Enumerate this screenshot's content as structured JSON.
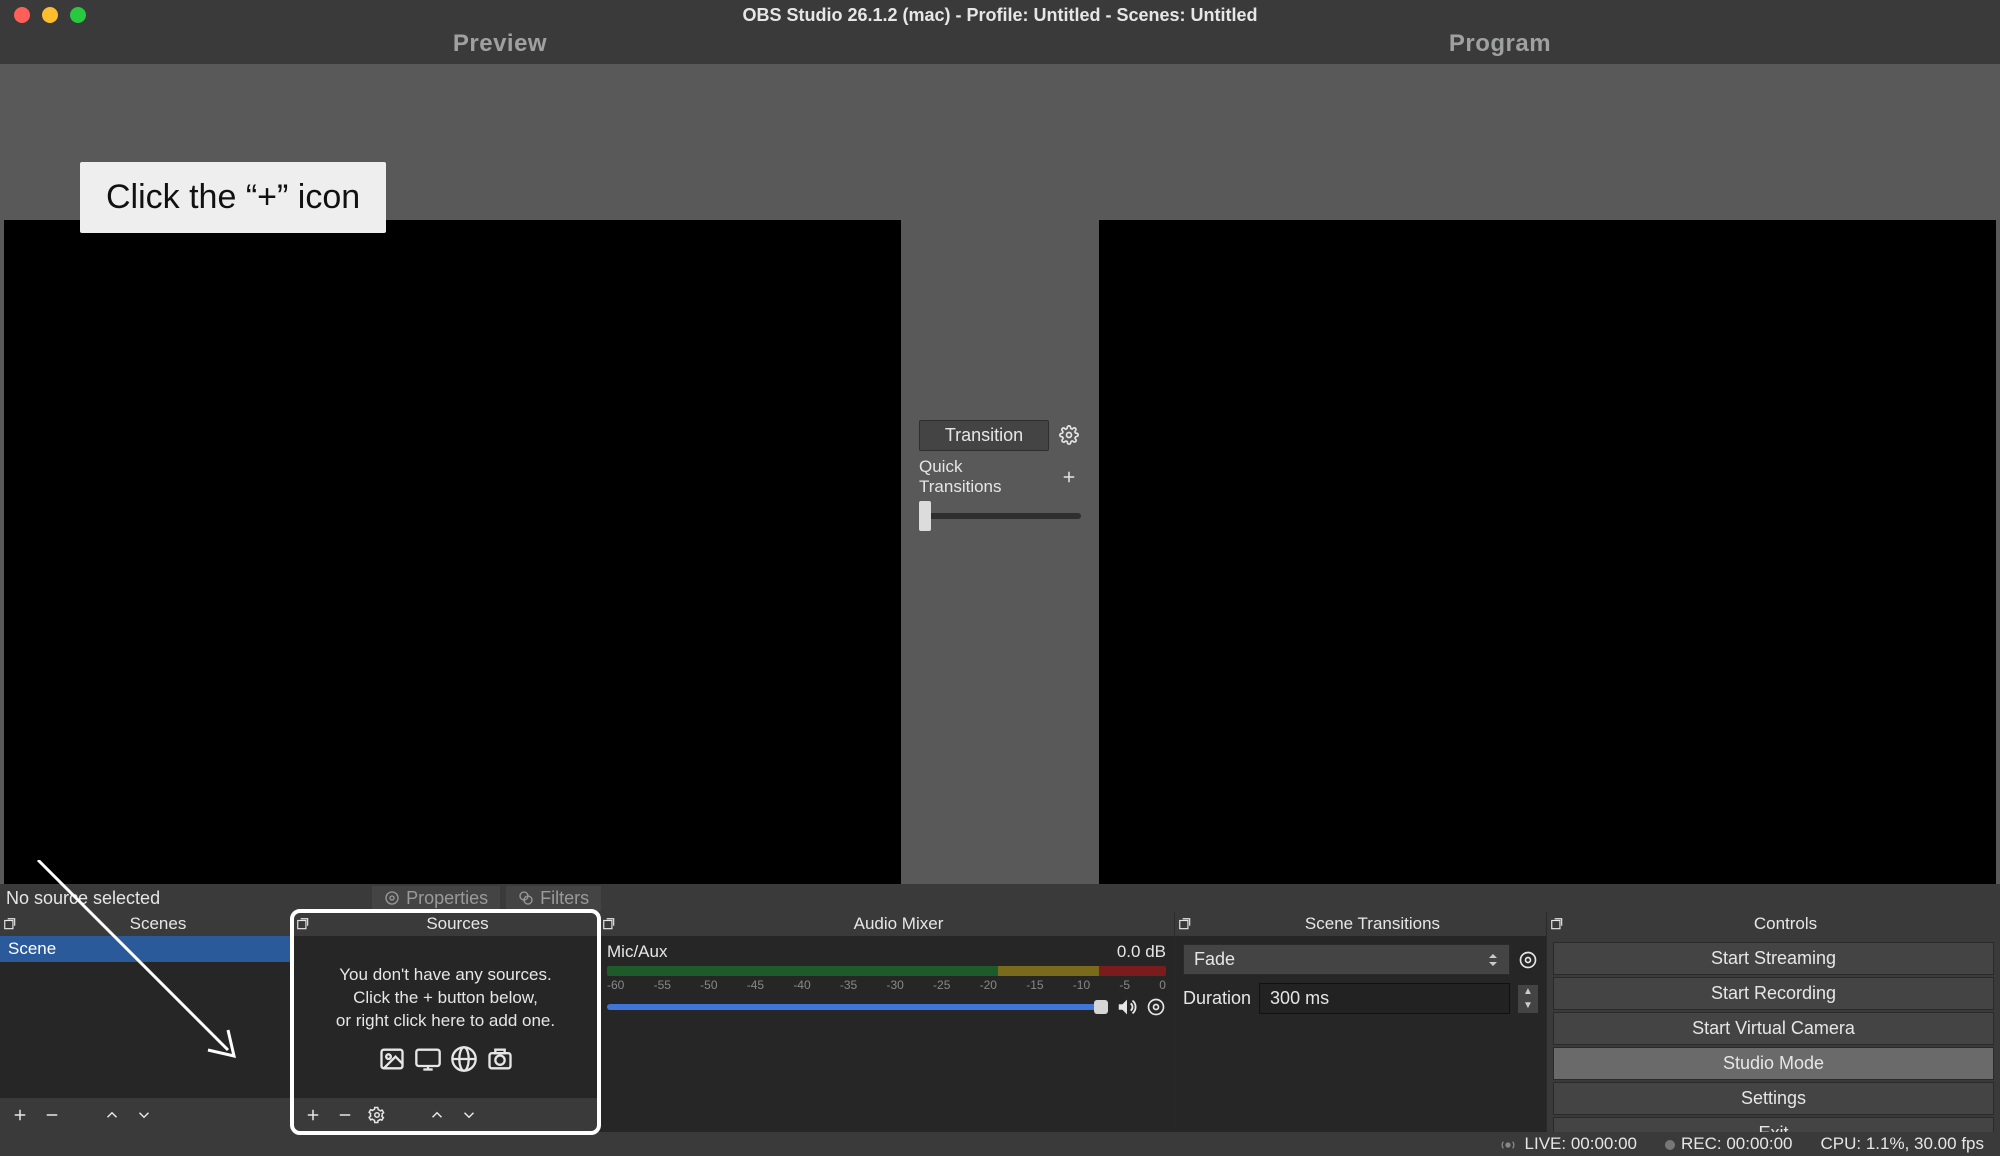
{
  "window": {
    "title": "OBS Studio 26.1.2 (mac) - Profile: Untitled - Scenes: Untitled"
  },
  "headers": {
    "preview": "Preview",
    "program": "Program"
  },
  "callout": "Click the “+” icon",
  "transition": {
    "button": "Transition",
    "quick_label": "Quick Transitions"
  },
  "infobar": {
    "no_source": "No source selected",
    "properties": "Properties",
    "filters": "Filters"
  },
  "docks": {
    "scenes": {
      "title": "Scenes",
      "items": [
        "Scene"
      ]
    },
    "sources": {
      "title": "Sources",
      "empty1": "You don't have any sources.",
      "empty2": "Click the + button below,",
      "empty3": "or right click here to add one."
    },
    "mixer": {
      "title": "Audio Mixer",
      "channel": "Mic/Aux",
      "level": "0.0 dB",
      "ticks": [
        "-60",
        "-55",
        "-50",
        "-45",
        "-40",
        "-35",
        "-30",
        "-25",
        "-20",
        "-15",
        "-10",
        "-5",
        "0"
      ]
    },
    "transitions": {
      "title": "Scene Transitions",
      "selected": "Fade",
      "duration_label": "Duration",
      "duration_value": "300 ms"
    },
    "controls": {
      "title": "Controls",
      "buttons": {
        "stream": "Start Streaming",
        "record": "Start Recording",
        "vcam": "Start Virtual Camera",
        "studio": "Studio Mode",
        "settings": "Settings",
        "exit": "Exit"
      }
    }
  },
  "status": {
    "live": "LIVE: 00:00:00",
    "rec": "REC: 00:00:00",
    "cpu": "CPU: 1.1%, 30.00 fps"
  }
}
